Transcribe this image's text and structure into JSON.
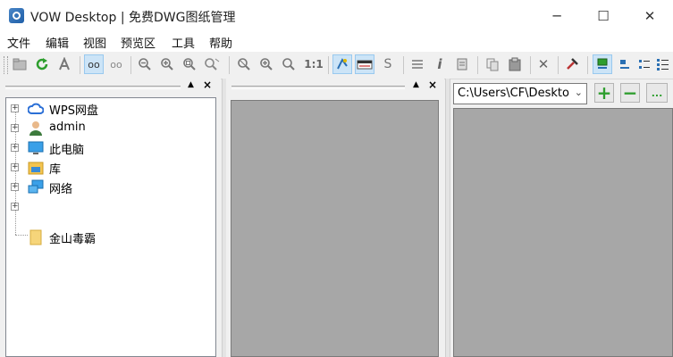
{
  "window": {
    "title": "VOW Desktop | 免费DWG图纸管理",
    "minimize_glyph": "─",
    "maximize_glyph": "☐",
    "close_glyph": "✕"
  },
  "menu": [
    "文件",
    "编辑",
    "视图",
    "预览区",
    "工具",
    "帮助"
  ],
  "toolbar": {
    "glyphs": {
      "loop_a": "oo",
      "loop_b": "oo",
      "one_to_one": "1:1",
      "s_text": "S",
      "info": "i",
      "close_x": "✕"
    },
    "icons": [
      "folder-icon",
      "refresh-icon",
      "cad-icon",
      "link-view-icon",
      "unlink-view-icon",
      "zoom-out-icon",
      "zoom-in-icon",
      "zoom-window-icon",
      "zoom-pan-icon",
      "zoom-all-icon",
      "zoom-realtime-icon",
      "zoom-fit-icon",
      "zoom-1-1-icon",
      "layer-icon",
      "image-mode-icon",
      "text-style-icon",
      "layers-list-icon",
      "info-icon",
      "print-preview-icon",
      "copy-icon",
      "paste-icon",
      "delete-icon",
      "tools-icon",
      "view-large-icon",
      "view-small-icon",
      "view-list-icon",
      "view-details-icon"
    ]
  },
  "left_panel": {
    "pin_glyph": "▲",
    "close_glyph": "×",
    "tree": [
      {
        "label": "WPS网盘",
        "icon": "cloud-icon",
        "expander": "+"
      },
      {
        "label": "admin",
        "icon": "user-icon",
        "expander": "+"
      },
      {
        "label": "此电脑",
        "icon": "computer-icon",
        "expander": "+"
      },
      {
        "label": "库",
        "icon": "library-icon",
        "expander": "+"
      },
      {
        "label": "网络",
        "icon": "network-icon",
        "expander": "+"
      },
      {
        "label": "",
        "icon": "",
        "expander": "+"
      },
      {
        "label": "金山毒霸",
        "icon": "folder-icon",
        "expander": ""
      }
    ]
  },
  "middle_panel": {
    "pin_glyph": "▲",
    "close_glyph": "×"
  },
  "right_panel": {
    "path_value": "C:\\Users\\CF\\Desktop",
    "dropdown_glyph": "⌄",
    "add_glyph": "+",
    "remove_glyph": "−",
    "more_glyph": "...",
    "accent_green": "#2e9e2e"
  }
}
